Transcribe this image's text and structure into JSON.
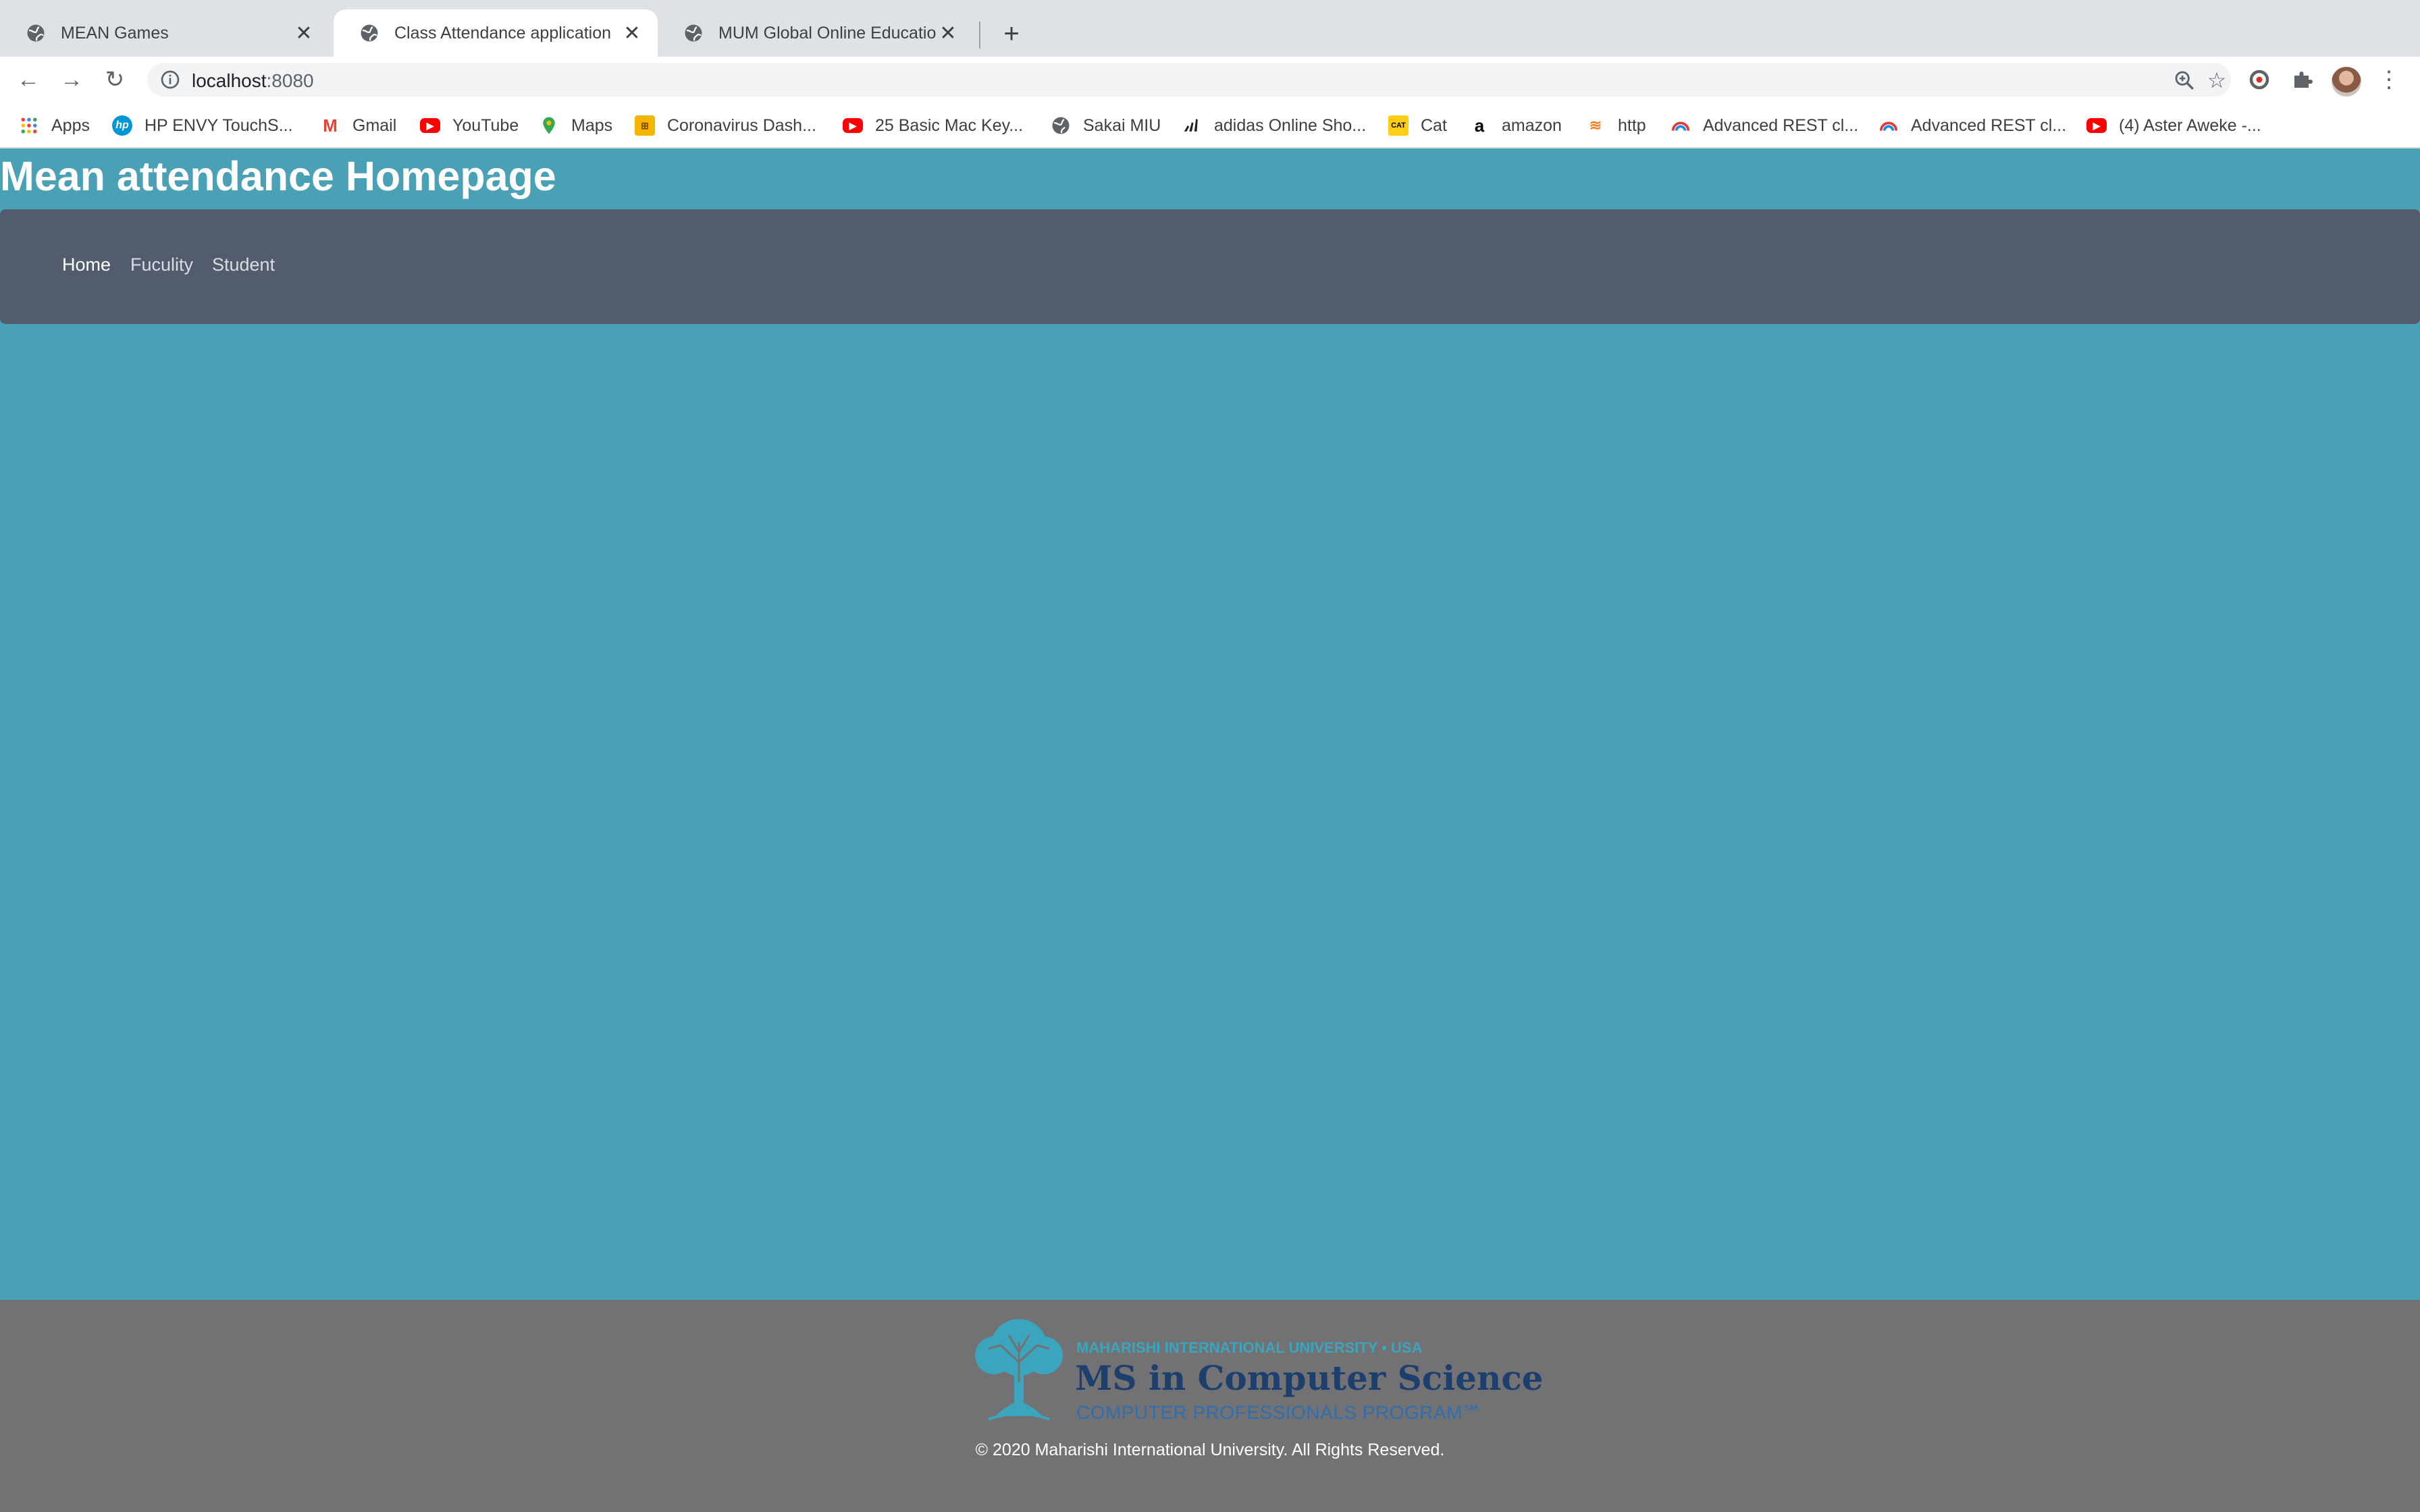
{
  "browser": {
    "tabs": [
      {
        "title": "MEAN Games",
        "active": false
      },
      {
        "title": "Class Attendance application",
        "active": true
      },
      {
        "title": "MUM Global Online Education",
        "active": false
      }
    ],
    "url_host": "localhost",
    "url_port": ":8080",
    "bookmarks": [
      {
        "label": "Apps",
        "icon": "apps-grid-icon"
      },
      {
        "label": "HP ENVY TouchS...",
        "icon": "hp-icon"
      },
      {
        "label": "Gmail",
        "icon": "gmail-icon"
      },
      {
        "label": "YouTube",
        "icon": "youtube-icon"
      },
      {
        "label": "Maps",
        "icon": "maps-pin-icon"
      },
      {
        "label": "Coronavirus Dash...",
        "icon": "dashboard-icon"
      },
      {
        "label": "25 Basic Mac Key...",
        "icon": "youtube-icon"
      },
      {
        "label": "Sakai MIU",
        "icon": "globe-icon"
      },
      {
        "label": "adidas Online Sho...",
        "icon": "adidas-icon"
      },
      {
        "label": "Cat",
        "icon": "cat-icon"
      },
      {
        "label": "amazon",
        "icon": "amazon-icon"
      },
      {
        "label": "http",
        "icon": "stack-icon"
      },
      {
        "label": "Advanced REST cl...",
        "icon": "rest-client-icon"
      },
      {
        "label": "Advanced REST cl...",
        "icon": "rest-client-icon"
      },
      {
        "label": "(4) Aster Aweke -...",
        "icon": "youtube-icon"
      }
    ]
  },
  "page": {
    "title": "Mean attendance Homepage",
    "nav": [
      {
        "label": "Home",
        "active": true
      },
      {
        "label": "Fuculity",
        "active": false
      },
      {
        "label": "Student",
        "active": false
      }
    ]
  },
  "footer": {
    "logo_line1": "MAHARISHI INTERNATIONAL UNIVERSITY • USA",
    "logo_line2": "MS in Computer Science",
    "logo_line3": "COMPUTER PROFESSIONALS PROGRAM℠",
    "copyright": "© 2020 Maharishi International University. All Rights Reserved."
  },
  "colors": {
    "page_background": "#4aa1b6",
    "navbar": "#525c6c",
    "footer": "#727173",
    "logo_teal": "#3ba5bd",
    "logo_navy": "#1c3f6e"
  }
}
